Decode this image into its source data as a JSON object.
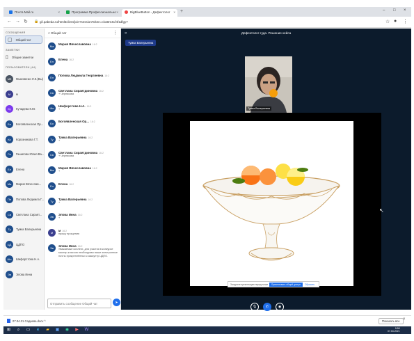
{
  "browser": {
    "tabs": [
      {
        "title": "Почта Mail.ru"
      },
      {
        "title": "Программа Профессионально"
      },
      {
        "title": "BigBlueButton - Дефектолог"
      }
    ],
    "address": "gil.pabeda.ru/html5client/join?sessionToken=ckoBm41f4f1dfgy7",
    "controls": {
      "minimize": "–",
      "maximize": "□",
      "close": "×"
    }
  },
  "sidebar": {
    "messages_header": "СООБЩЕНИЯ",
    "public_chat": "Общий чат",
    "notes_header": "ЗАМЕТКИ",
    "shared_notes": "Общие заметки",
    "users_header": "ПОЛЬЗОВАТЕЛИ (44)",
    "users": [
      {
        "initials": "Мб",
        "name": "Мыковенко Л.К.(Вы)",
        "color": "#4b5563"
      },
      {
        "initials": "М",
        "name": "м",
        "color": "#3b3f8f"
      },
      {
        "initials": "Ку",
        "name": "Кучадева К.Ю.",
        "color": "#7c3aed"
      },
      {
        "initials": "Бо",
        "name": "Богоявленская Ор...",
        "color": "#1f4e8c"
      },
      {
        "initials": "Ко",
        "name": "Корозникова Г.Т.",
        "color": "#1f4e8c"
      },
      {
        "initials": "Га",
        "name": "Гашигова Юлия Ва...",
        "color": "#1f4e8c"
      },
      {
        "initials": "Ел",
        "name": "Елена",
        "color": "#1f4e8c"
      },
      {
        "initials": "Ма",
        "name": "Мария Вячеслав...",
        "color": "#1f4e8c"
      },
      {
        "initials": "Пе",
        "name": "Попова Людмила Г...",
        "color": "#1f4e8c"
      },
      {
        "initials": "Св",
        "name": "Светлана Сираят...",
        "color": "#1f4e8c"
      },
      {
        "initials": "Ту",
        "name": "Тумка Валерьевна",
        "color": "#1f4e8c"
      },
      {
        "initials": "ЦД",
        "name": "ЦДПО",
        "color": "#1f4e8c"
      },
      {
        "initials": "Шо",
        "name": "Шифорстова Н.А.",
        "color": "#1f4e8c"
      },
      {
        "initials": "Эв",
        "name": "Элова Инна",
        "color": "#1f4e8c"
      }
    ]
  },
  "chat": {
    "header": "< Общий чат",
    "messages": [
      {
        "initials": "Ма",
        "name": "Мария Вячеславовна",
        "time": "16:2",
        "text": "",
        "color": "#1f4e8c"
      },
      {
        "initials": "Ел",
        "name": "Елена",
        "time": "16:2",
        "text": "",
        "color": "#1f4e8c"
      },
      {
        "initials": "Пл",
        "name": "Попова Людмила Георгиевна",
        "time": "16:2",
        "text": "",
        "color": "#1f4e8c"
      },
      {
        "initials": "Св",
        "name": "Светлана Сираятдиновна",
        "time": "16:2",
        "text": "+ Черникова",
        "color": "#1f4e8c"
      },
      {
        "initials": "Ши",
        "name": "Шифорстова Н.А.",
        "time": "16:2",
        "text": "+",
        "color": "#1f4e8c"
      },
      {
        "initials": "Бо",
        "name": "Богоявленская Ор...",
        "time": "16:2",
        "text": "",
        "color": "#1f4e8c"
      },
      {
        "initials": "Ту",
        "name": "Тумка Валерьевна",
        "time": "16:2",
        "text": "+",
        "color": "#1f4e8c"
      },
      {
        "initials": "Св",
        "name": "Светлана Сираятдиновна",
        "time": "16:2",
        "text": "+ Черникова",
        "color": "#1f4e8c"
      },
      {
        "initials": "Ма",
        "name": "Мария Вячеславовна",
        "time": "16:2",
        "text": "+",
        "color": "#1f4e8c"
      },
      {
        "initials": "Ел",
        "name": "Елена",
        "time": "16:2",
        "text": "",
        "color": "#1f4e8c"
      },
      {
        "initials": "Ту",
        "name": "Тумка Валерьевна",
        "time": "16:2",
        "text": "+",
        "color": "#1f4e8c"
      },
      {
        "initials": "Эв",
        "name": "Элова Инна",
        "time": "16:2",
        "text": "+",
        "color": "#1f4e8c"
      },
      {
        "initials": "М",
        "name": "м",
        "time": "16:2",
        "text": "прошу прощения",
        "color": "#3b3f8f"
      }
    ],
    "last_message": {
      "initials": "Эв",
      "name": "Элова Инна",
      "time": "16:2",
      "text": "Уважаемые коллеги, для участия в конкурсе мастер-классов необходимы ваши электронные почты прикреплённых к аккаунту ЦДПО.",
      "color": "#1f4e8c"
    },
    "input_placeholder": "Отправить сообщение Общий чат",
    "send_icon": "➤"
  },
  "main": {
    "room_title": "Дефектолог-гуда. Решение кейса",
    "presenter_badge": "Тумка Валерьевна",
    "webcam_label": "Тумка Валерьевна",
    "slide_toolbar": {
      "text": "Загрузите презентацию перед началом",
      "button": "Презентовать общий доступ",
      "link": "Сбросить"
    },
    "controls": [
      {
        "icon": "mic-icon",
        "glyph": "🎙",
        "active": false
      },
      {
        "icon": "phone-icon",
        "glyph": "✆",
        "active": true
      },
      {
        "icon": "camera-icon",
        "glyph": "◉",
        "active": false
      }
    ]
  },
  "downloads": {
    "file": "07.04.21 Садиева.docx",
    "show_all": "Показать все",
    "close": "×"
  },
  "taskbar": {
    "time": "9:58",
    "date": "07.04.2021"
  }
}
